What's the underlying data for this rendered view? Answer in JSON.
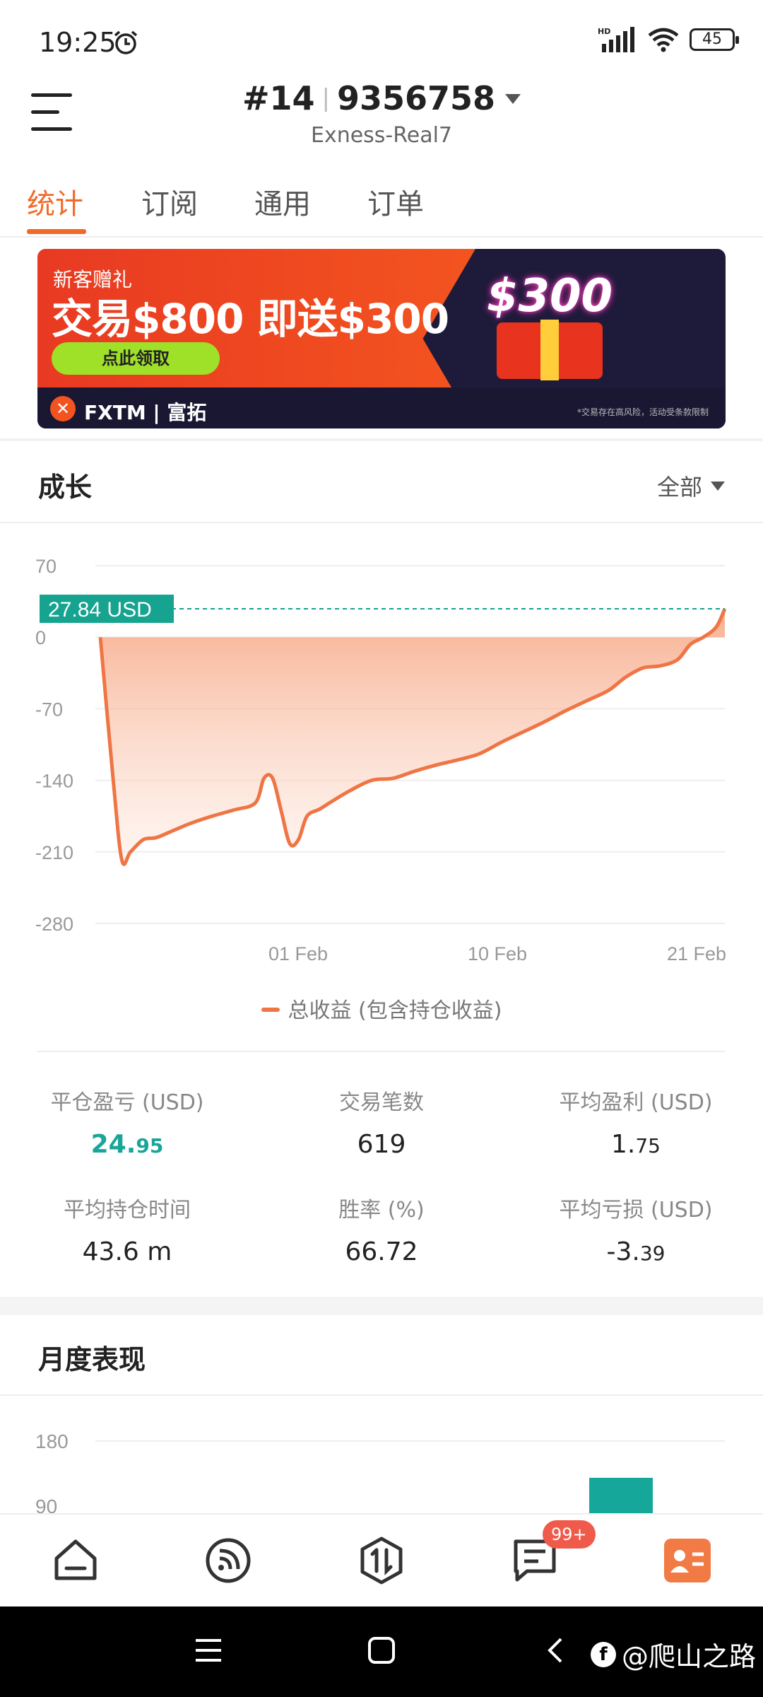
{
  "status_bar": {
    "time": "19:25",
    "battery": "45",
    "network": "HD"
  },
  "header": {
    "account_prefix": "#14",
    "account_number": "9356758",
    "server": "Exness-Real7"
  },
  "tabs": [
    {
      "label": "统计",
      "active": true
    },
    {
      "label": "订阅",
      "active": false
    },
    {
      "label": "通用",
      "active": false
    },
    {
      "label": "订单",
      "active": false
    }
  ],
  "banner": {
    "subtitle": "新客赠礼",
    "headline": "交易$800 即送$300",
    "cta": "点此领取",
    "brand": "FXTM | 富拓",
    "gift_label": "$300",
    "disclaimer": "*交易存在高风险，活动受条款限制"
  },
  "growth": {
    "title": "成长",
    "filter": "全部",
    "current_value_label": "27.84 USD",
    "legend": "总收益 (包含持仓收益)"
  },
  "chart_data": {
    "type": "area",
    "title": "成长",
    "ylim": [
      -280,
      70
    ],
    "y_ticks": [
      "70",
      "0",
      "-70",
      "-140",
      "-210",
      "-280"
    ],
    "x_ticks": [
      "01 Feb",
      "10 Feb",
      "21 Feb"
    ],
    "series": [
      {
        "name": "总收益 (包含持仓收益)",
        "color": "#ef7545",
        "points": [
          [
            0,
            0
          ],
          [
            3,
            -140
          ],
          [
            5,
            -218
          ],
          [
            7,
            -210
          ],
          [
            10,
            -198
          ],
          [
            13,
            -196
          ],
          [
            17,
            -189
          ],
          [
            21,
            -182
          ],
          [
            26,
            -175
          ],
          [
            31,
            -169
          ],
          [
            36,
            -162
          ],
          [
            38,
            -138
          ],
          [
            40,
            -138
          ],
          [
            42,
            -170
          ],
          [
            44,
            -202
          ],
          [
            46,
            -198
          ],
          [
            48,
            -175
          ],
          [
            51,
            -168
          ],
          [
            54,
            -160
          ],
          [
            58,
            -150
          ],
          [
            63,
            -140
          ],
          [
            68,
            -138
          ],
          [
            73,
            -131
          ],
          [
            78,
            -125
          ],
          [
            83,
            -120
          ],
          [
            88,
            -114
          ],
          [
            93,
            -103
          ],
          [
            98,
            -93
          ],
          [
            103,
            -83
          ],
          [
            108,
            -72
          ],
          [
            113,
            -62
          ],
          [
            118,
            -52
          ],
          [
            122,
            -39
          ],
          [
            126,
            -30
          ],
          [
            130,
            -28
          ],
          [
            134,
            -22
          ],
          [
            137,
            -7
          ],
          [
            140,
            0
          ],
          [
            143,
            10
          ],
          [
            145,
            27.84
          ]
        ]
      }
    ],
    "reference_line": 27.84
  },
  "stats": [
    {
      "label": "平仓盈亏 (USD)",
      "value_main": "24.",
      "value_small": "95",
      "highlight": true
    },
    {
      "label": "交易笔数",
      "value_main": "619",
      "value_small": ""
    },
    {
      "label": "平均盈利 (USD)",
      "value_main": "1.",
      "value_small": "75"
    },
    {
      "label": "平均持仓时间",
      "value_main": "43.6 m",
      "value_small": ""
    },
    {
      "label": "胜率 (%)",
      "value_main": "66.72",
      "value_small": ""
    },
    {
      "label": "平均亏损 (USD)",
      "value_main": "-3.",
      "value_small": "39"
    }
  ],
  "monthly": {
    "title": "月度表现",
    "y_ticks": [
      "180",
      "90"
    ],
    "bar_color": "#15a89a"
  },
  "bottom_nav": {
    "badge": "99+",
    "items": [
      "home-icon",
      "feed-icon",
      "trade-icon",
      "messages-icon",
      "profile-icon"
    ],
    "active_color": "#f27a44"
  },
  "watermark": "@爬山之路"
}
